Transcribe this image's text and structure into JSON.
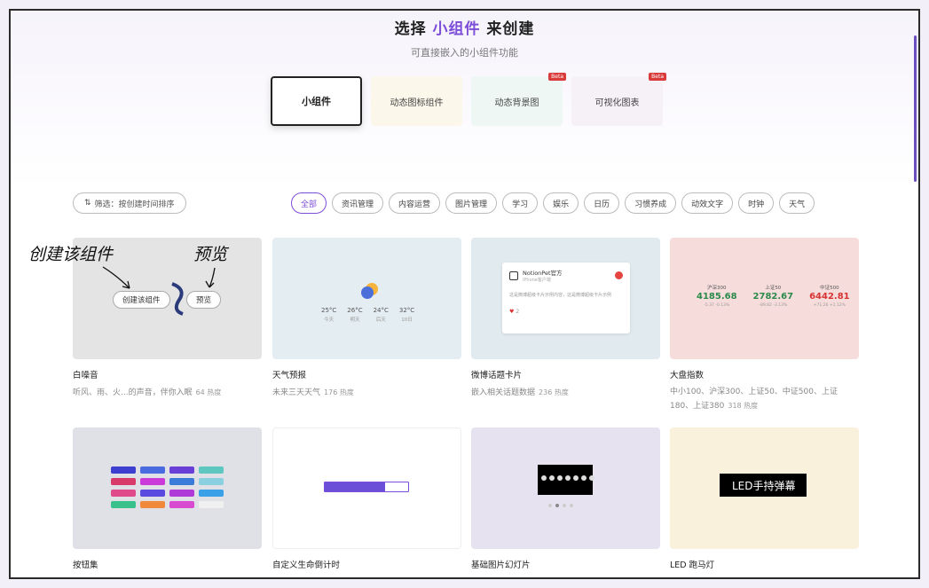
{
  "header": {
    "title_prefix": "选择 ",
    "title_accent": "小组件",
    "title_suffix": " 来创建",
    "subtitle": "可直接嵌入的小组件功能",
    "accent_color": "#7c4dd8"
  },
  "type_tabs": [
    {
      "label": "小组件",
      "active": true,
      "beta": ""
    },
    {
      "label": "动态图标组件",
      "active": false,
      "beta": ""
    },
    {
      "label": "动态背景图",
      "active": false,
      "beta": "Beta"
    },
    {
      "label": "可视化图表",
      "active": false,
      "beta": "Beta"
    }
  ],
  "filter": {
    "sort_icon": "filter-icon",
    "sort_label": "筛选：按创建时间排序"
  },
  "categories": [
    "全部",
    "资讯管理",
    "内容运营",
    "图片管理",
    "学习",
    "娱乐",
    "日历",
    "习惯养成",
    "动效文字",
    "时钟",
    "天气"
  ],
  "annotations": {
    "create": "创建该组件",
    "preview": "预览"
  },
  "hover_buttons": {
    "create": "创建该组件",
    "preview": "预览"
  },
  "weather_preview": {
    "days": [
      {
        "temp": "25°C",
        "label": "今天"
      },
      {
        "temp": "26°C",
        "label": "明天"
      },
      {
        "temp": "24°C",
        "label": "后天"
      },
      {
        "temp": "32°C",
        "label": "10日"
      }
    ]
  },
  "weibo_preview": {
    "name": "NotionPet官方",
    "sub": "iPhone客户端",
    "text": "这是微博超级卡片示例内容，这是微博超级卡片示例",
    "likes": "2"
  },
  "index_preview": [
    {
      "name": "沪深300",
      "value": "4185.68",
      "change": "-5.37 -0.13%",
      "color": "#2a8a4a"
    },
    {
      "name": "上证50",
      "value": "2782.67",
      "change": "-89.82 -3.13%",
      "color": "#2a8a4a"
    },
    {
      "name": "中证500",
      "value": "6442.81",
      "change": "+71.26 +1.12%",
      "color": "#d63333"
    }
  ],
  "led_preview": {
    "text": "LED手持弹幕"
  },
  "progress_preview": {
    "fraction": 0.72
  },
  "cards": [
    {
      "title": "白噪音",
      "desc": "听风、雨、火...的声音，伴你入眠",
      "heat": "64 热度"
    },
    {
      "title": "天气预报",
      "desc": "未来三天天气",
      "heat": "176 热度"
    },
    {
      "title": "微博话题卡片",
      "desc": "嵌入相关话题数据",
      "heat": "236 热度"
    },
    {
      "title": "大盘指数",
      "desc": "中小100、沪深300、上证50、中证500、上证180、上证380",
      "heat": "318 热度"
    },
    {
      "title": "按钮集",
      "desc": "",
      "heat": ""
    },
    {
      "title": "自定义生命倒计时",
      "desc": "",
      "heat": ""
    },
    {
      "title": "基础图片幻灯片",
      "desc": "",
      "heat": ""
    },
    {
      "title": "LED 跑马灯",
      "desc": "",
      "heat": ""
    }
  ]
}
